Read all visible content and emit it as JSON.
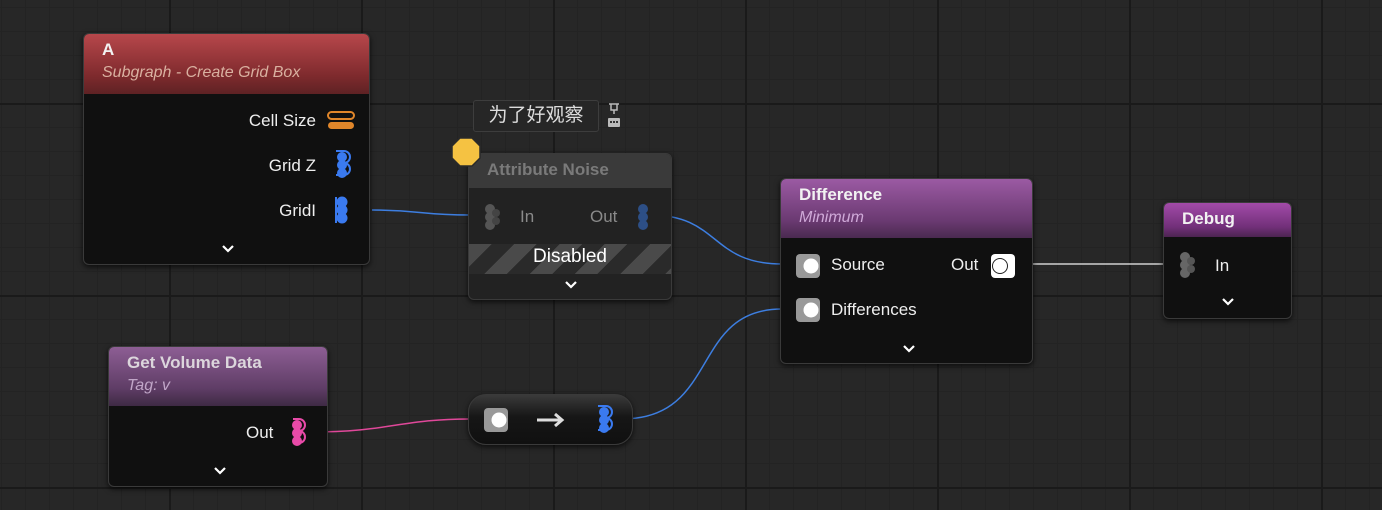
{
  "comment": {
    "text": "为了好观察"
  },
  "nodes": {
    "a": {
      "title": "A",
      "subtitle": "Subgraph - Create Grid Box",
      "pins": [
        "Cell Size",
        "Grid Z",
        "GridI"
      ]
    },
    "attribute_noise": {
      "title": "Attribute Noise",
      "in_label": "In",
      "out_label": "Out",
      "status": "Disabled"
    },
    "difference": {
      "title": "Difference",
      "subtitle": "Minimum",
      "source_label": "Source",
      "out_label": "Out",
      "differences_label": "Differences"
    },
    "debug": {
      "title": "Debug",
      "in_label": "In"
    },
    "get_volume_data": {
      "title": "Get Volume Data",
      "subtitle": "Tag: v",
      "out_label": "Out"
    }
  },
  "colors": {
    "wire_blue": "#3d7ee0",
    "wire_pink": "#e0489a",
    "wire_white": "#d0d0d0",
    "pin_orange": "#e0862a",
    "pin_blue": "#3a7af0",
    "pin_pink": "#e84aa8",
    "warning_yellow": "#f5c242"
  }
}
